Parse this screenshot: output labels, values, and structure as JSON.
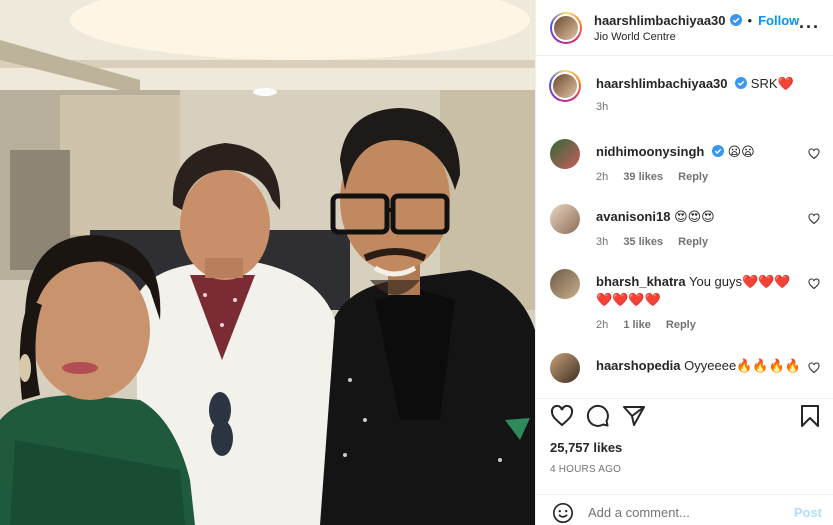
{
  "header": {
    "username": "haarshlimbachiyaa30",
    "dot": "•",
    "follow_label": "Follow",
    "location": "Jio World Centre",
    "more": "···"
  },
  "caption": {
    "username": "haarshlimbachiyaa30",
    "text": "SRK❤️",
    "time": "3h"
  },
  "comments": [
    {
      "username": "nidhimoonysingh",
      "verified": true,
      "text": "😦😦",
      "time": "2h",
      "likes": "39 likes",
      "reply": "Reply"
    },
    {
      "username": "avanisoni18",
      "verified": false,
      "text": "😍😍😍",
      "time": "3h",
      "likes": "35 likes",
      "reply": "Reply"
    },
    {
      "username": "bharsh_khatra",
      "verified": false,
      "text": "You guys❤️❤️❤️❤️❤️❤️❤️",
      "time": "2h",
      "likes": "1 like",
      "reply": "Reply"
    },
    {
      "username": "haarshopedia",
      "verified": false,
      "text": "Oyyeeee🔥🔥🔥🔥",
      "time": "",
      "likes": "",
      "reply": ""
    }
  ],
  "likes_count": "25,757 likes",
  "timestamp": "4 HOURS AGO",
  "add_comment": {
    "placeholder": "Add a comment...",
    "post_label": "Post"
  },
  "colors": {
    "accent": "#0095f6",
    "verified": "#3897f0",
    "muted": "#737373",
    "post_disabled": "#b3dbff"
  },
  "icons": [
    "verified-icon",
    "more-icon",
    "heart-icon",
    "comment-icon",
    "share-icon",
    "bookmark-icon",
    "emoji-icon"
  ]
}
